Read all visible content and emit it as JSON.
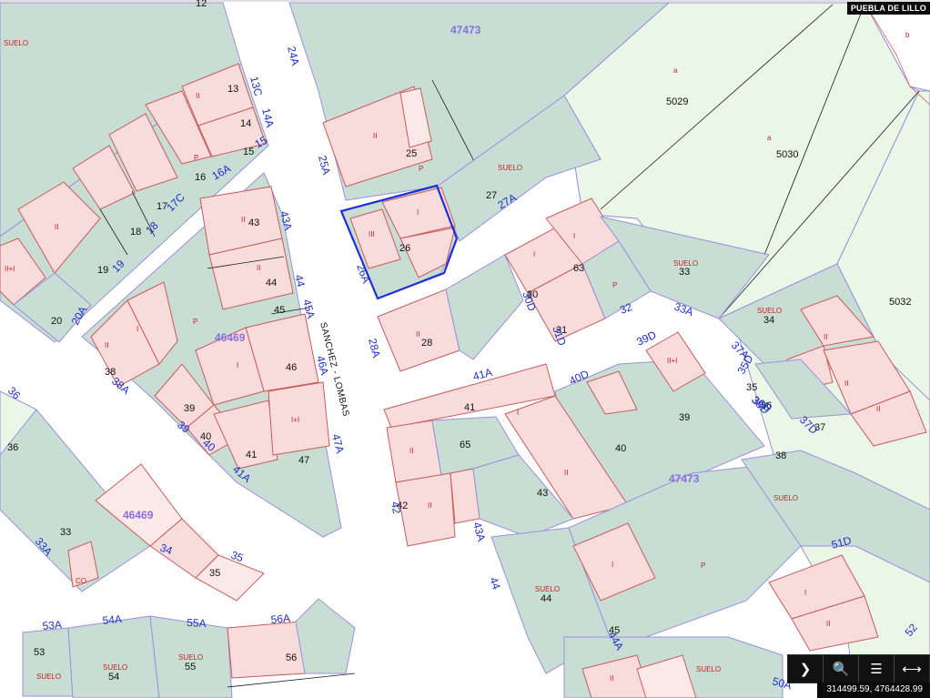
{
  "place_label": "PUEBLA DE LILLO",
  "coordinates_text": "314499.59, 4764428.99",
  "toolbar": {
    "items": [
      {
        "name": "next-button",
        "icon": "chevron-right-icon",
        "glyph": "❯"
      },
      {
        "name": "zoom-button",
        "icon": "search-icon",
        "glyph": "🔍"
      },
      {
        "name": "layers-button",
        "icon": "layers-icon",
        "glyph": "☰"
      },
      {
        "name": "measure-button",
        "icon": "measure-icon",
        "glyph": "⟷"
      }
    ]
  },
  "map": {
    "street_name": "SANCHEZ - LOMBAS",
    "polygon_labels": [
      "47473",
      "46469",
      "46469",
      "47473"
    ],
    "parcel_numbers": [
      "12",
      "13",
      "14",
      "15",
      "16",
      "17",
      "18",
      "19",
      "20",
      "25",
      "26",
      "27",
      "28",
      "30",
      "31",
      "33",
      "34",
      "35",
      "36",
      "36",
      "37",
      "38",
      "38",
      "39",
      "39",
      "40",
      "40",
      "41",
      "41",
      "42",
      "43",
      "43",
      "44",
      "44",
      "45",
      "45",
      "46",
      "47",
      "53",
      "54",
      "55",
      "56",
      "63",
      "65",
      "5029",
      "5030",
      "5032",
      "33",
      "35"
    ],
    "street_numbers": [
      "24A",
      "25A",
      "26A",
      "27A",
      "28A",
      "13C",
      "14A",
      "15",
      "16A",
      "17C",
      "18",
      "19",
      "20A",
      "43A",
      "44",
      "45A",
      "46A",
      "47A",
      "38A",
      "39",
      "40",
      "41A",
      "41A",
      "40D",
      "39D",
      "38D",
      "37D",
      "37A",
      "36",
      "35",
      "34",
      "33A",
      "33A",
      "32",
      "31D",
      "30D",
      "42",
      "43A",
      "44",
      "44A",
      "35D",
      "36D",
      "51D",
      "53A",
      "54A",
      "55A",
      "56A",
      "50A",
      "52"
    ],
    "use_labels": [
      "SUELO",
      "II",
      "I",
      "P",
      "II+I",
      "III",
      "I+I",
      "CO",
      "a",
      "b"
    ]
  }
}
